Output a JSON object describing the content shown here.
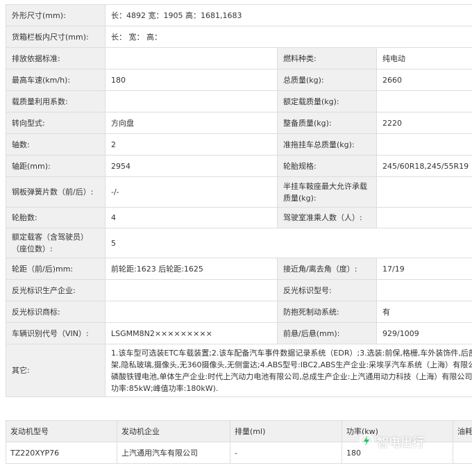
{
  "spec": {
    "dimensions": {
      "label": "外形尺寸(mm):",
      "value": "长：4892 宽：1905 高：1681,1683"
    },
    "cargo_box": {
      "label": "货箱栏板内尺寸(mm):",
      "value": "长：  宽：  高："
    },
    "emission_std": {
      "label": "排放依据标准:",
      "value": ""
    },
    "fuel_type": {
      "label": "燃料种类:",
      "value": "纯电动"
    },
    "max_speed": {
      "label": "最高车速(km/h):",
      "value": "180"
    },
    "gross_mass": {
      "label": "总质量(kg):",
      "value": "2660"
    },
    "load_util": {
      "label": "载质量利用系数:",
      "value": ""
    },
    "rated_load": {
      "label": "额定载质量(kg):",
      "value": ""
    },
    "steering": {
      "label": "转向型式:",
      "value": "方向盘"
    },
    "curb_mass": {
      "label": "整备质量(kg):",
      "value": "2220"
    },
    "axles": {
      "label": "轴数:",
      "value": "2"
    },
    "trailer_mass": {
      "label": "准拖挂车总质量(kg):",
      "value": ""
    },
    "wheelbase": {
      "label": "轴距(mm):",
      "value": "2954"
    },
    "tire_spec": {
      "label": "轮胎规格:",
      "value": "245/60R18,245/55R19"
    },
    "leaf_springs": {
      "label": "钢板弹簧片数（前/后）:",
      "value": "-/-"
    },
    "saddle_load": {
      "label": "半挂车鞍座最大允许承载质量(kg):",
      "value": ""
    },
    "tire_count": {
      "label": "轮胎数:",
      "value": "4"
    },
    "cab_seats": {
      "label": "驾驶室准乘人数（人）:",
      "value": ""
    },
    "rated_seats": {
      "label": "额定载客（含驾驶员）（座位数）:",
      "value": "5"
    },
    "track": {
      "label": "轮距（前/后)mm:",
      "value": "前轮距:1623 后轮距:1625"
    },
    "approach_departure": {
      "label": "接近角/离去角（度）:",
      "value": "17/19"
    },
    "reflector_maker": {
      "label": "反光标识生产企业:",
      "value": ""
    },
    "reflector_model": {
      "label": "反光标识型号:",
      "value": ""
    },
    "reflector_brand": {
      "label": "反光标识商标:",
      "value": ""
    },
    "abs": {
      "label": "防抱死制动系统:",
      "value": "有"
    },
    "vin": {
      "label": "车辆识别代号（VIN）:",
      "value": "LSGMM8N2×××××××××"
    },
    "overhang": {
      "label": "前悬/后悬(mm):",
      "value": "929/1009"
    },
    "other": {
      "label": "其它:",
      "lines": [
        "1.该车型可选装ETC车载装置;2.该车配备汽车事件数据记录系统（EDR）;3.选装:前保,格栅,车外装饰件,后部",
        "架,隐私玻璃,摄像头,无360摄像头,无侧雷达;4.ABS型号:IBC2,ABS生产企业:采埃孚汽车系统（上海）有限公",
        "磷酸铁锂电池,单体生产企业:时代上汽动力电池有限公司,总成生产企业:上汽通用动力科技（上海）有限公司",
        "功率:85kW;峰值功率:180kW)."
      ]
    }
  },
  "engine": {
    "headers": [
      "发动机型号",
      "发动机企业",
      "排量(ml)",
      "功率(kw)",
      "油耗"
    ],
    "row": [
      "TZ220XYP76",
      "上汽通用汽车有限公司",
      "-",
      "180",
      ""
    ]
  },
  "watermark": {
    "text": "智电出行",
    "icon": "lightning-bolt-icon"
  }
}
